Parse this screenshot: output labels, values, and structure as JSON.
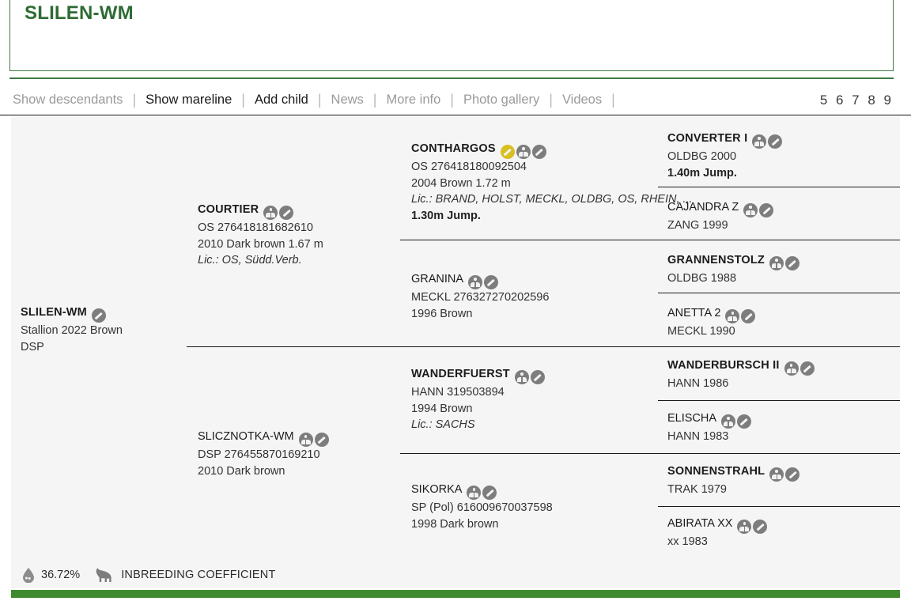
{
  "header": {
    "title": "SLILEN-WM"
  },
  "nav": {
    "links": [
      {
        "label": "Show descendants",
        "active": false
      },
      {
        "label": "Show mareline",
        "active": true
      },
      {
        "label": "Add child",
        "active": true
      },
      {
        "label": "News",
        "active": false
      },
      {
        "label": "More info",
        "active": false
      },
      {
        "label": "Photo gallery",
        "active": false
      },
      {
        "label": "Videos",
        "active": false
      }
    ],
    "separator": "|",
    "pager": "5 6 7 8 9"
  },
  "pedigree": {
    "subject": {
      "name": "SLILEN-WM",
      "stallion": true,
      "icons": [
        "edit-icon"
      ],
      "lines": [
        {
          "text": "Stallion 2022 Brown",
          "style": "normal"
        },
        {
          "text": "DSP",
          "style": "normal"
        }
      ]
    },
    "gen1": [
      {
        "name": "COURTIER",
        "stallion": true,
        "icons": [
          "pedigree-icon",
          "edit-icon"
        ],
        "lines": [
          {
            "text": "OS 276418181682610",
            "style": "normal"
          },
          {
            "text": "2010 Dark brown 1.67 m",
            "style": "normal"
          },
          {
            "text": "Lic.: OS, Südd.Verb.",
            "style": "italic"
          }
        ]
      },
      {
        "name": "SLICZNOTKA-WM",
        "stallion": false,
        "icons": [
          "pedigree-icon",
          "edit-icon"
        ],
        "lines": [
          {
            "text": "DSP 276455870169210",
            "style": "normal"
          },
          {
            "text": "2010 Dark brown",
            "style": "normal"
          }
        ]
      }
    ],
    "gen2": [
      {
        "name": "CONTHARGOS",
        "stallion": true,
        "icons": [
          "edit-icon-gold",
          "pedigree-icon",
          "edit-icon"
        ],
        "lines": [
          {
            "text": "OS 276418180092504",
            "style": "normal"
          },
          {
            "text": "2004 Brown 1.72 m",
            "style": "normal"
          },
          {
            "text": "Lic.: BRAND, HOLST, MECKL, OLDBG, OS, RHEIN, ...",
            "style": "italic"
          },
          {
            "text": "1.30m Jump.",
            "style": "bold"
          }
        ]
      },
      {
        "name": "GRANINA",
        "stallion": false,
        "icons": [
          "pedigree-icon",
          "edit-icon"
        ],
        "lines": [
          {
            "text": "MECKL 276327270202596",
            "style": "normal"
          },
          {
            "text": "1996 Brown",
            "style": "normal"
          }
        ]
      },
      {
        "name": "WANDERFUERST",
        "stallion": true,
        "icons": [
          "pedigree-icon",
          "edit-icon"
        ],
        "lines": [
          {
            "text": "HANN 319503894",
            "style": "normal"
          },
          {
            "text": "1994 Brown",
            "style": "normal"
          },
          {
            "text": "Lic.: SACHS",
            "style": "italic"
          }
        ]
      },
      {
        "name": "SIKORKA",
        "stallion": false,
        "icons": [
          "pedigree-icon",
          "edit-icon"
        ],
        "lines": [
          {
            "text": "SP (Pol) 616009670037598",
            "style": "normal"
          },
          {
            "text": "1998 Dark brown",
            "style": "normal"
          }
        ]
      }
    ],
    "gen3": [
      {
        "name": "CONVERTER I",
        "stallion": true,
        "icons": [
          "pedigree-icon",
          "edit-icon"
        ],
        "lines": [
          {
            "text": "OLDBG 2000",
            "style": "normal"
          },
          {
            "text": "1.40m Jump.",
            "style": "bold"
          }
        ]
      },
      {
        "name": "CAJANDRA Z",
        "stallion": false,
        "icons": [
          "pedigree-icon",
          "edit-icon"
        ],
        "lines": [
          {
            "text": "ZANG 1999",
            "style": "normal"
          }
        ]
      },
      {
        "name": "GRANNENSTOLZ",
        "stallion": true,
        "icons": [
          "pedigree-icon",
          "edit-icon"
        ],
        "lines": [
          {
            "text": "OLDBG 1988",
            "style": "normal"
          }
        ]
      },
      {
        "name": "ANETTA 2",
        "stallion": false,
        "icons": [
          "pedigree-icon",
          "edit-icon"
        ],
        "lines": [
          {
            "text": "MECKL 1990",
            "style": "normal"
          }
        ]
      },
      {
        "name": "WANDERBURSCH II",
        "stallion": true,
        "icons": [
          "pedigree-icon",
          "edit-icon"
        ],
        "lines": [
          {
            "text": "HANN 1986",
            "style": "normal"
          }
        ]
      },
      {
        "name": "ELISCHA",
        "stallion": false,
        "icons": [
          "pedigree-icon",
          "edit-icon"
        ],
        "lines": [
          {
            "text": "HANN 1983",
            "style": "normal"
          }
        ]
      },
      {
        "name": "SONNENSTRAHL",
        "stallion": true,
        "icons": [
          "pedigree-icon",
          "edit-icon"
        ],
        "lines": [
          {
            "text": "TRAK 1979",
            "style": "normal"
          }
        ]
      },
      {
        "name": "ABIRATA XX",
        "stallion": false,
        "icons": [
          "pedigree-icon",
          "edit-icon"
        ],
        "lines": [
          {
            "text": "xx 1983",
            "style": "normal"
          }
        ]
      }
    ]
  },
  "footer": {
    "coefficient_value": "36.72%",
    "coefficient_label": "INBREEDING COEFFICIENT"
  },
  "colors": {
    "brand_green": "#2e6b34",
    "footer_green": "#3f8a2f",
    "panel_bg": "#f5f5f5",
    "icon_gray": "#7d7d7d",
    "icon_gold": "#d9c021"
  }
}
